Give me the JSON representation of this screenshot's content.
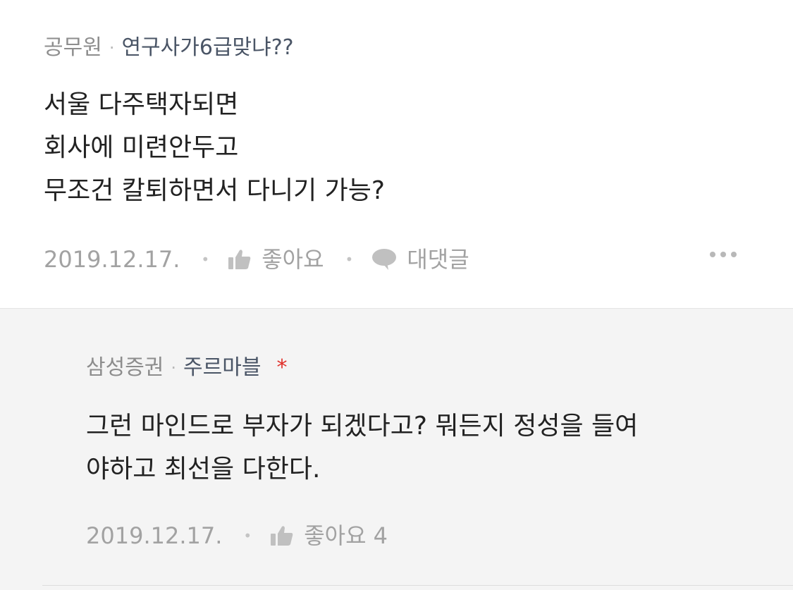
{
  "post": {
    "company": "공무원",
    "nickname": "연구사가6급맞냐??",
    "lines": [
      "서울 다주택자되면",
      "회사에 미련안두고",
      "무조건 칼퇴하면서 다니기 가능?"
    ],
    "date": "2019.12.17.",
    "like_label": "좋아요",
    "comment_label": "대댓글"
  },
  "reply": {
    "company": "삼성증권",
    "nickname": "주르마블",
    "author_mark": "*",
    "lines": [
      "그런 마인드로 부자가 되겠다고? 뭐든지 정성을 들여",
      "야하고 최선을 다한다."
    ],
    "date": "2019.12.17.",
    "like_label": "좋아요 4"
  },
  "icons": {
    "like": "thumbs-up-icon",
    "comment": "speech-bubble-icon",
    "more": "more-options-icon"
  },
  "colors": {
    "reply_background": "#f4f4f4",
    "author_mark": "#e0302a",
    "nickname": "#4a5566"
  }
}
